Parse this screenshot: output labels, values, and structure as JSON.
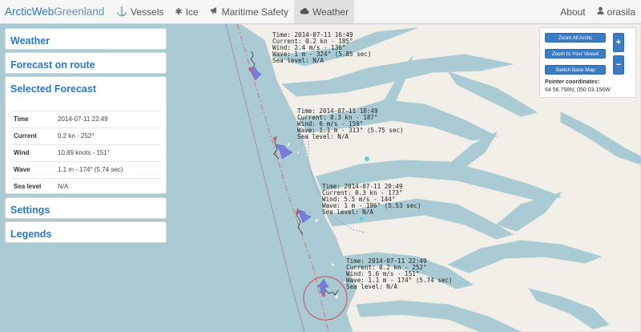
{
  "navbar": {
    "brand_part1": "ArcticWeb",
    "brand_part2": "Greenland",
    "items": [
      {
        "label": "Vessels",
        "icon": "anchor-icon"
      },
      {
        "label": "Ice",
        "icon": "snowflake-icon"
      },
      {
        "label": "Maritime Safety",
        "icon": "megaphone-icon"
      },
      {
        "label": "Weather",
        "icon": "cloud-icon",
        "active": true
      }
    ],
    "about": "About",
    "user": "orasila"
  },
  "sidebar": {
    "weather": "Weather",
    "forecast_on_route": "Forecast on route",
    "selected_forecast": "Selected Forecast",
    "forecast_table": [
      {
        "key": "Time",
        "value": "2014-07-11 22:49"
      },
      {
        "key": "Current",
        "value": "0.2 kn - 252°"
      },
      {
        "key": "Wind",
        "value": "10.89 knots - 151°"
      },
      {
        "key": "Wave",
        "value": "1.1 m - 174° (5.74 sec)"
      },
      {
        "key": "Sea level",
        "value": "N/A"
      }
    ],
    "settings": "Settings",
    "legends": "Legends"
  },
  "map_labels": [
    {
      "time": "Time: 2014-07-11 16:49",
      "current": "Current: 0.2 kn - 185°",
      "wind": "Wind: 2.4 m/s - 136°",
      "wave": "Wave: 1 m - 324° (5.85 sec)",
      "sea": "Sea level: N/A"
    },
    {
      "time": "Time: 2014-07-11 18:49",
      "current": "Current: 0.3 kn - 187°",
      "wind": "Wind: 6 m/s - 159°",
      "wave": "Wave: 1.1 m - 313° (5.75 sec)",
      "sea": "Sea level: N/A"
    },
    {
      "time": "Time: 2014-07-11 20:49",
      "current": "Current: 0.3 kn - 173°",
      "wind": "Wind: 5.5 m/s - 144°",
      "wave": "Wave: 1 m - 196° (5.53 sec)",
      "sea": "Sea level: N/A"
    },
    {
      "time": "Time: 2014-07-11 22:49",
      "current": "Current: 0.2 kn - 252°",
      "wind": "Wind: 5.6 m/s - 151°",
      "wave": "Wave: 1.1 m - 174° (5.74 sec)",
      "sea": "Sea level: N/A"
    }
  ],
  "map_controls": {
    "zoom_all": "Zoom All Arctic",
    "zoom_vessel": "Zoom to Your Vessel",
    "switch_base": "Switch Base Map",
    "zoom_in": "+",
    "zoom_out": "−",
    "pointer_title": "Pointer coordinates:",
    "pointer_value": "64 56.756N, 050 03.156W"
  },
  "colors": {
    "accent": "#2a77c4",
    "sea": "#aacbd3",
    "land": "#f1efe8",
    "route": "#d8707a",
    "arrow": "#7b7bdc"
  }
}
